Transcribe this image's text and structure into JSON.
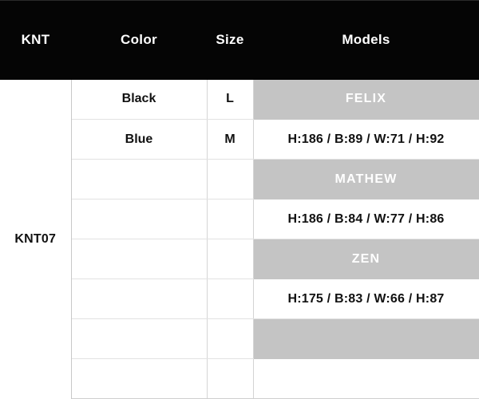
{
  "table": {
    "headers": {
      "knt": "KNT",
      "color": "Color",
      "size": "Size",
      "models": "Models"
    },
    "knt_code": "KNT07",
    "rows": [
      {
        "color": "Black",
        "size": "L",
        "models": "FELIX",
        "models_style": "name"
      },
      {
        "color": "Blue",
        "size": "M",
        "models": "H:186 / B:89 / W:71 / H:92",
        "models_style": "measure"
      },
      {
        "color": "",
        "size": "",
        "models": "MATHEW",
        "models_style": "name"
      },
      {
        "color": "",
        "size": "",
        "models": "H:186 / B:84 / W:77 / H:86",
        "models_style": "measure"
      },
      {
        "color": "",
        "size": "",
        "models": "ZEN",
        "models_style": "name"
      },
      {
        "color": "",
        "size": "",
        "models": "H:175 / B:83 / W:66 / H:87",
        "models_style": "measure"
      },
      {
        "color": "",
        "size": "",
        "models": "",
        "models_style": "blank-gray"
      },
      {
        "color": "",
        "size": "",
        "models": "",
        "models_style": "measure"
      }
    ]
  },
  "colors": {
    "header_background": "#050505",
    "header_text": "#ffffff",
    "model_name_background": "#c4c4c4",
    "model_name_text": "#ffffff",
    "cell_text": "#111111",
    "grid_line": "#d4d4d4"
  }
}
